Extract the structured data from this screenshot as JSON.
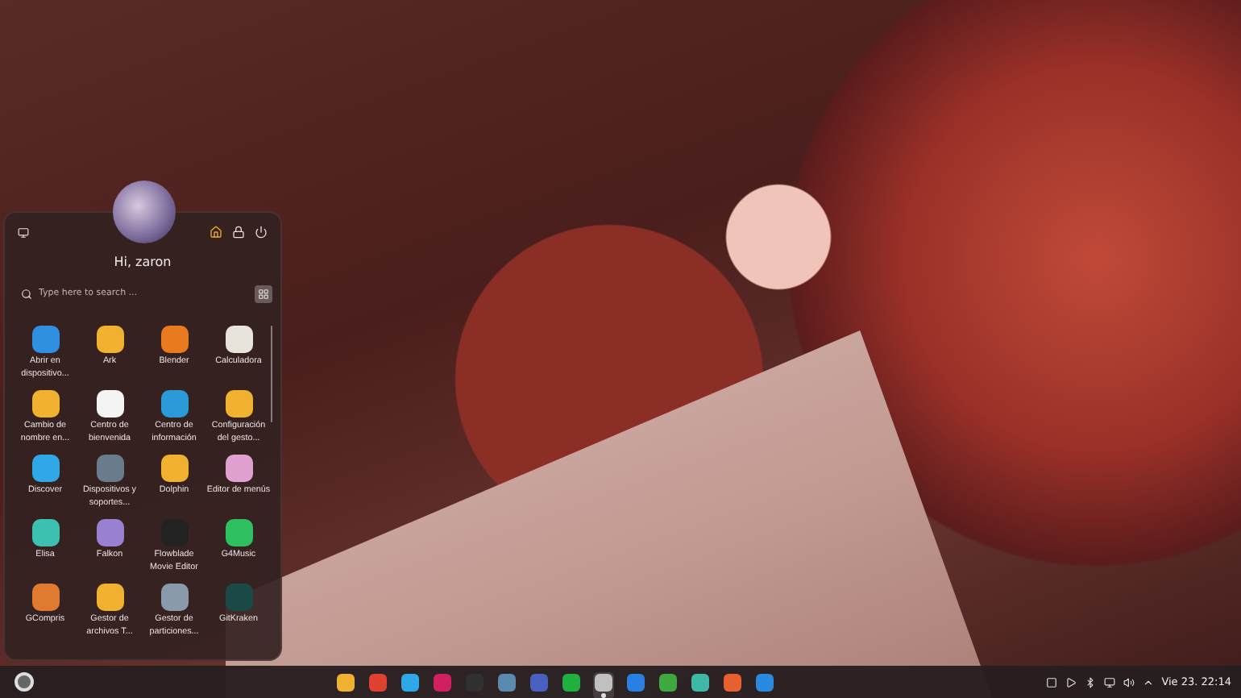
{
  "launcher": {
    "greeting": "Hi, zaron",
    "search": {
      "placeholder": "Type here to search ..."
    },
    "apps": [
      {
        "label": "Abrir en dispositivo...",
        "color": "#2f8fe0"
      },
      {
        "label": "Ark",
        "color": "#f0b030"
      },
      {
        "label": "Blender",
        "color": "#ea7a20"
      },
      {
        "label": "Calculadora",
        "color": "#e8e4dc"
      },
      {
        "label": "Cambio de nombre en...",
        "color": "#f0b030"
      },
      {
        "label": "Centro de bienvenida",
        "color": "#f4f4f4"
      },
      {
        "label": "Centro de información",
        "color": "#2a9ad8"
      },
      {
        "label": "Configuración del gesto...",
        "color": "#f0b030"
      },
      {
        "label": "Discover",
        "color": "#30a8e8"
      },
      {
        "label": "Dispositivos y soportes...",
        "color": "#6a7c8c"
      },
      {
        "label": "Dolphin",
        "color": "#f0b030"
      },
      {
        "label": "Editor de menús",
        "color": "#e0a0d0"
      },
      {
        "label": "Elisa",
        "color": "#3cc0b0"
      },
      {
        "label": "Falkon",
        "color": "#9a80d0"
      },
      {
        "label": "Flowblade Movie Editor",
        "color": "#222222"
      },
      {
        "label": "G4Music",
        "color": "#2ec060"
      },
      {
        "label": "GCompris",
        "color": "#e07a30"
      },
      {
        "label": "Gestor de archivos T...",
        "color": "#f0b030"
      },
      {
        "label": "Gestor de particiones...",
        "color": "#8a9aaa"
      },
      {
        "label": "GitKraken",
        "color": "#1a4a48"
      }
    ]
  },
  "taskbar": {
    "apps": [
      {
        "color": "#f0b030",
        "selected": false
      },
      {
        "color": "#e04030",
        "selected": false
      },
      {
        "color": "#30a8e8",
        "selected": false
      },
      {
        "color": "#d02060",
        "selected": false
      },
      {
        "color": "#303030",
        "selected": false
      },
      {
        "color": "#5a8ab0",
        "selected": false
      },
      {
        "color": "#4a60c0",
        "selected": false
      },
      {
        "color": "#20b040",
        "selected": false
      },
      {
        "color": "#c0c0c0",
        "selected": true
      },
      {
        "color": "#2a80e0",
        "selected": false
      },
      {
        "color": "#40a840",
        "selected": false
      },
      {
        "color": "#40b8a8",
        "selected": false
      },
      {
        "color": "#e86030",
        "selected": false
      },
      {
        "color": "#2a8ae0",
        "selected": false
      }
    ],
    "clock": "Vie 23. 22:14"
  }
}
